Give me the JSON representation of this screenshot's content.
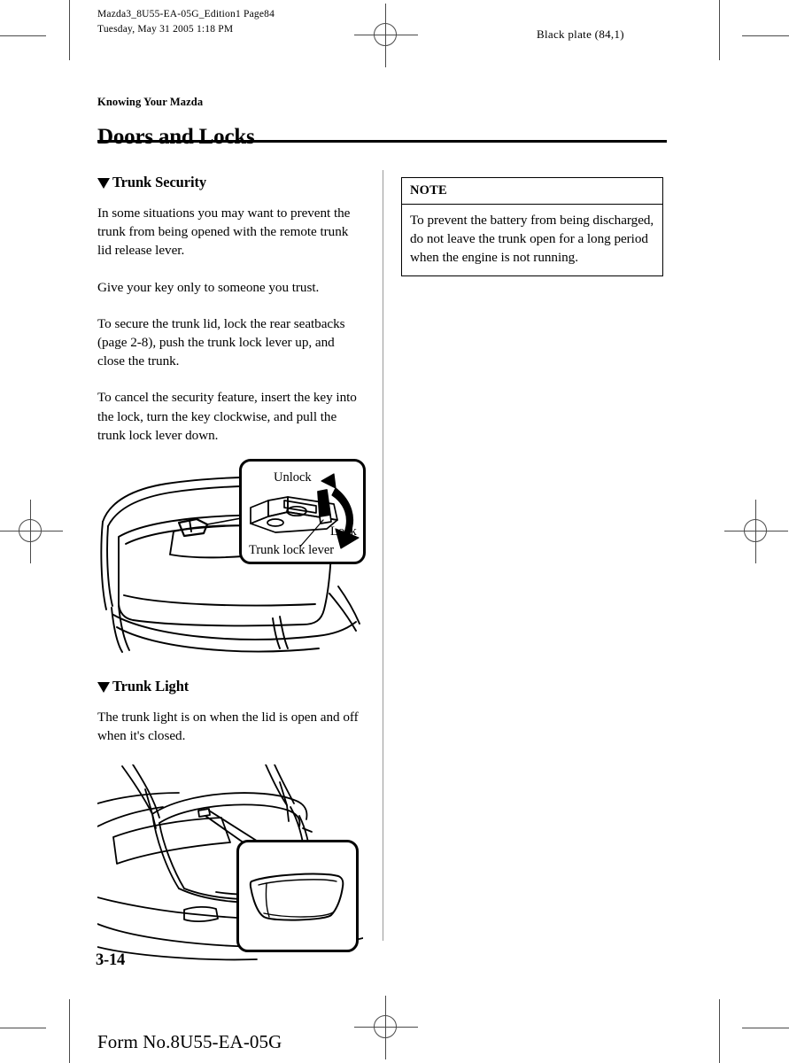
{
  "print_marks": {
    "registration_icon": "registration-target-icon",
    "crop_line_icon": "crop-mark-line"
  },
  "running_head": {
    "left": "Mazda3_8U55-EA-05G_Edition1 Page84\nTuesday, May 31 2005 1:18 PM",
    "right": "Black plate (84,1)"
  },
  "chapter": {
    "kicker": "Knowing Your Mazda",
    "title": "Doors and Locks"
  },
  "left_column": {
    "section1": {
      "heading": "Trunk Security",
      "bullet_icon": "triangle-down-icon",
      "paragraphs": [
        "In some situations you may want to prevent the trunk from being opened with the remote trunk lid release lever.",
        "Give your key only to someone you trust.",
        "To secure the trunk lid, lock the rear seatbacks (page 2-8), push the trunk lock lever up, and close the trunk.",
        "To cancel the security feature, insert the key into the lock, turn the key clockwise, and pull the trunk lock lever down."
      ],
      "figure": {
        "name": "trunk-lock-lever-illustration",
        "callout_labels": {
          "unlock": "Unlock",
          "lock": "Lock",
          "part": "Trunk lock lever"
        },
        "arrow_icon": "curved-double-arrow-icon"
      }
    },
    "section2": {
      "heading": "Trunk Light",
      "bullet_icon": "triangle-down-icon",
      "paragraphs": [
        "The trunk light is on when the lid is open and off when it's closed."
      ],
      "figure": {
        "name": "trunk-light-illustration",
        "callout_labels": {}
      }
    }
  },
  "right_column": {
    "note": {
      "title": "NOTE",
      "body": "To prevent the battery from being discharged, do not leave the trunk open for a long period when the engine is not running."
    }
  },
  "footer": {
    "folio": "3-14",
    "form_number": "Form No.8U55-EA-05G"
  },
  "colors": {
    "text": "#000000",
    "rule": "#000000",
    "divider": "#9a9a9a",
    "crop_mark": "#4a4a4a",
    "page_background": "#ffffff"
  }
}
